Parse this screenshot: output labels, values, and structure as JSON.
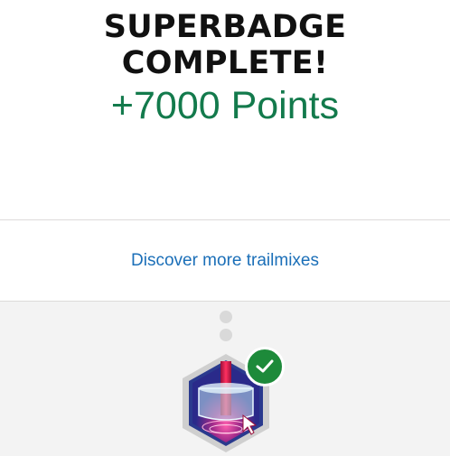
{
  "header": {
    "title": "SUPERBADGE COMPLETE!",
    "points": "+7000 Points"
  },
  "actions": {
    "discover_link": "Discover more trailmixes"
  },
  "badge": {
    "icon": "superbadge-hexagon-icon",
    "status_icon": "checkmark-icon",
    "status_color": "#1d8a3a"
  },
  "colors": {
    "points_green": "#137a4c",
    "link_blue": "#1b6fb8",
    "bottom_bg": "#f3f3f3"
  }
}
